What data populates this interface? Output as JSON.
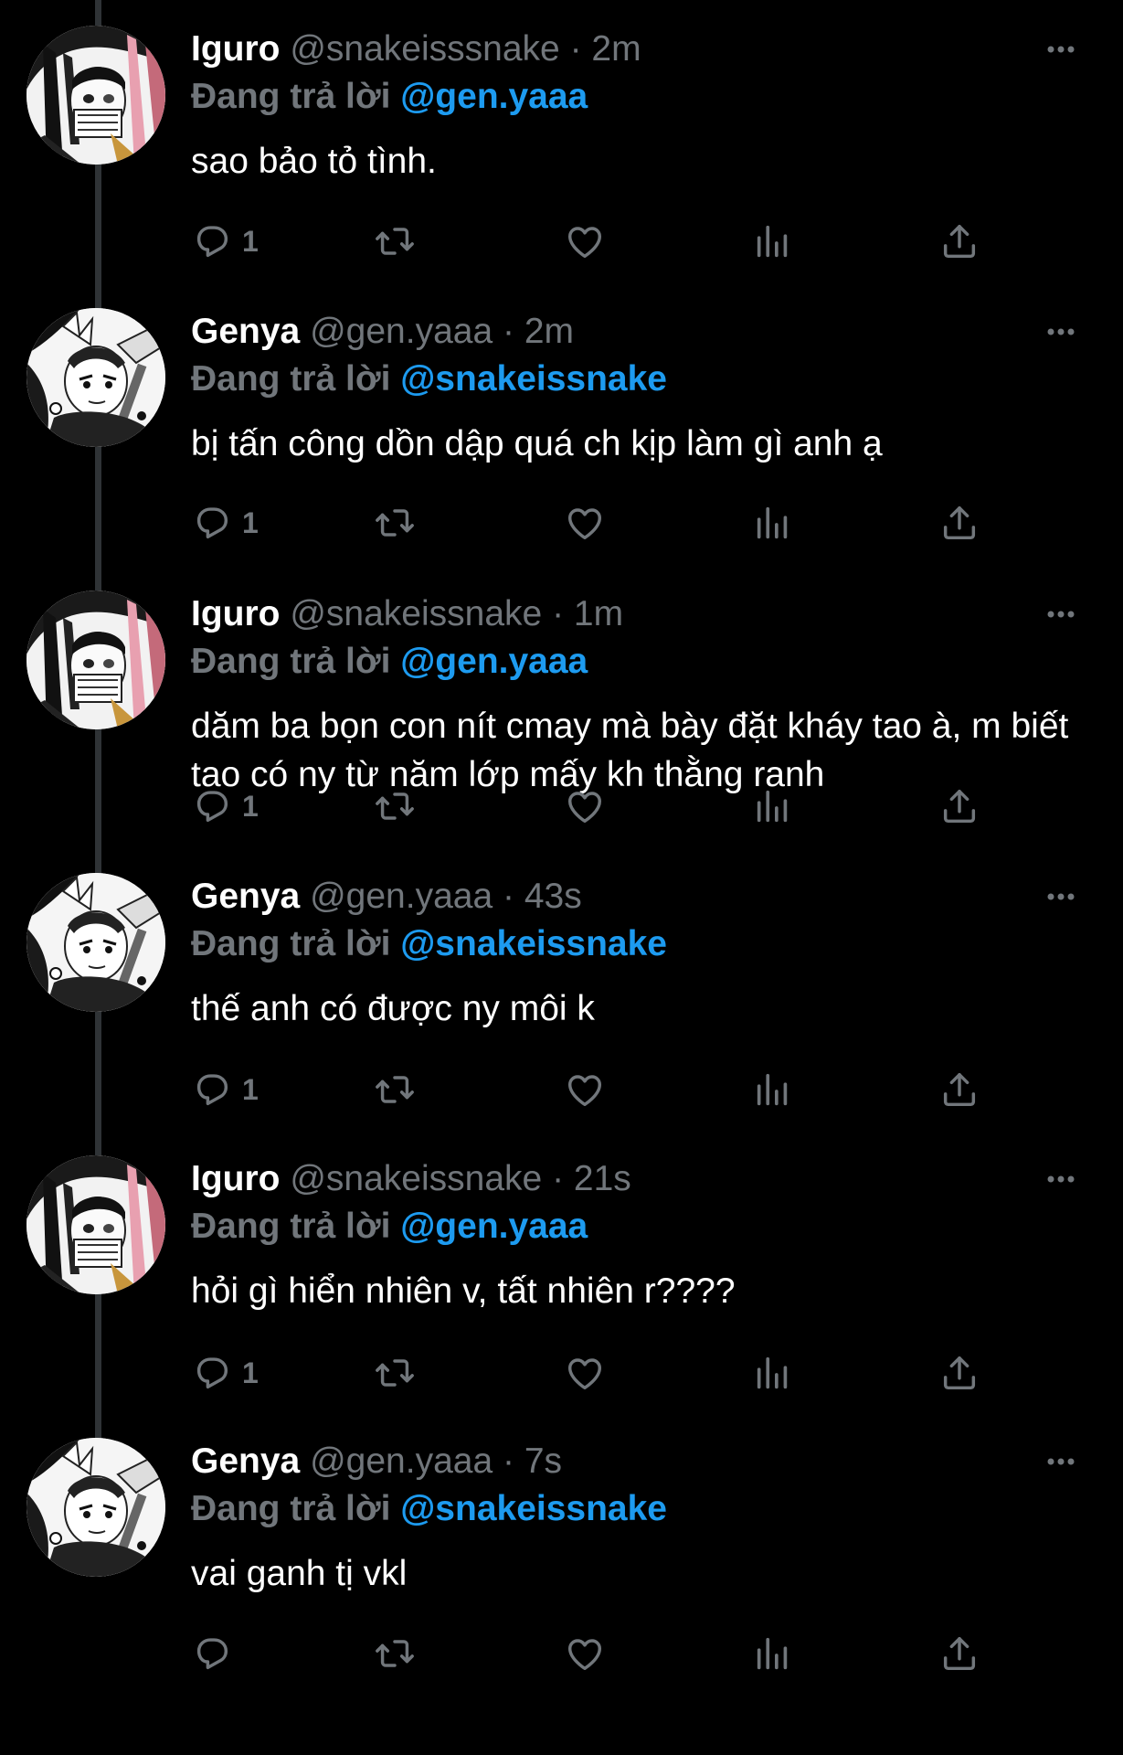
{
  "colors": {
    "background": "#000000",
    "text": "#ffffff",
    "secondary": "#71767b",
    "accent": "#1d9bf0",
    "thread_line": "#2f3336"
  },
  "tweets": [
    {
      "name": "Iguro",
      "handle": "@snakeisssnake",
      "separator": "·",
      "time": "2m",
      "reply_prefix": "Đang trả lời",
      "reply_to": "@gen.yaaa",
      "text": "sao bảo tỏ tình.",
      "reply_count": "1",
      "avatar": "iguro-avatar"
    },
    {
      "name": "Genya",
      "handle": "@gen.yaaa",
      "separator": "·",
      "time": "2m",
      "reply_prefix": "Đang trả lời",
      "reply_to": "@snakeissnake",
      "text": "bị tấn công dồn dập quá ch kịp làm gì anh ạ",
      "reply_count": "1",
      "avatar": "genya-avatar"
    },
    {
      "name": "Iguro",
      "handle": "@snakeissnake",
      "separator": "·",
      "time": "1m",
      "reply_prefix": "Đang trả lời",
      "reply_to": "@gen.yaaa",
      "text": "dăm ba bọn con nít cmay mà bày đặt kháy tao à, m biết tao có ny từ năm lớp mấy kh thằng ranh",
      "reply_count": "1",
      "avatar": "iguro-avatar"
    },
    {
      "name": "Genya",
      "handle": "@gen.yaaa",
      "separator": "·",
      "time": "43s",
      "reply_prefix": "Đang trả lời",
      "reply_to": "@snakeissnake",
      "text": "thế anh có được ny môi k",
      "reply_count": "1",
      "avatar": "genya-avatar"
    },
    {
      "name": "Iguro",
      "handle": "@snakeissnake",
      "separator": "·",
      "time": "21s",
      "reply_prefix": "Đang trả lời",
      "reply_to": "@gen.yaaa",
      "text": "hỏi gì hiển nhiên v, tất nhiên r????",
      "reply_count": "1",
      "avatar": "iguro-avatar"
    },
    {
      "name": "Genya",
      "handle": "@gen.yaaa",
      "separator": "·",
      "time": "7s",
      "reply_prefix": "Đang trả lời",
      "reply_to": "@snakeissnake",
      "text": "vai ganh tị vkl",
      "reply_count": "",
      "avatar": "genya-avatar"
    }
  ]
}
